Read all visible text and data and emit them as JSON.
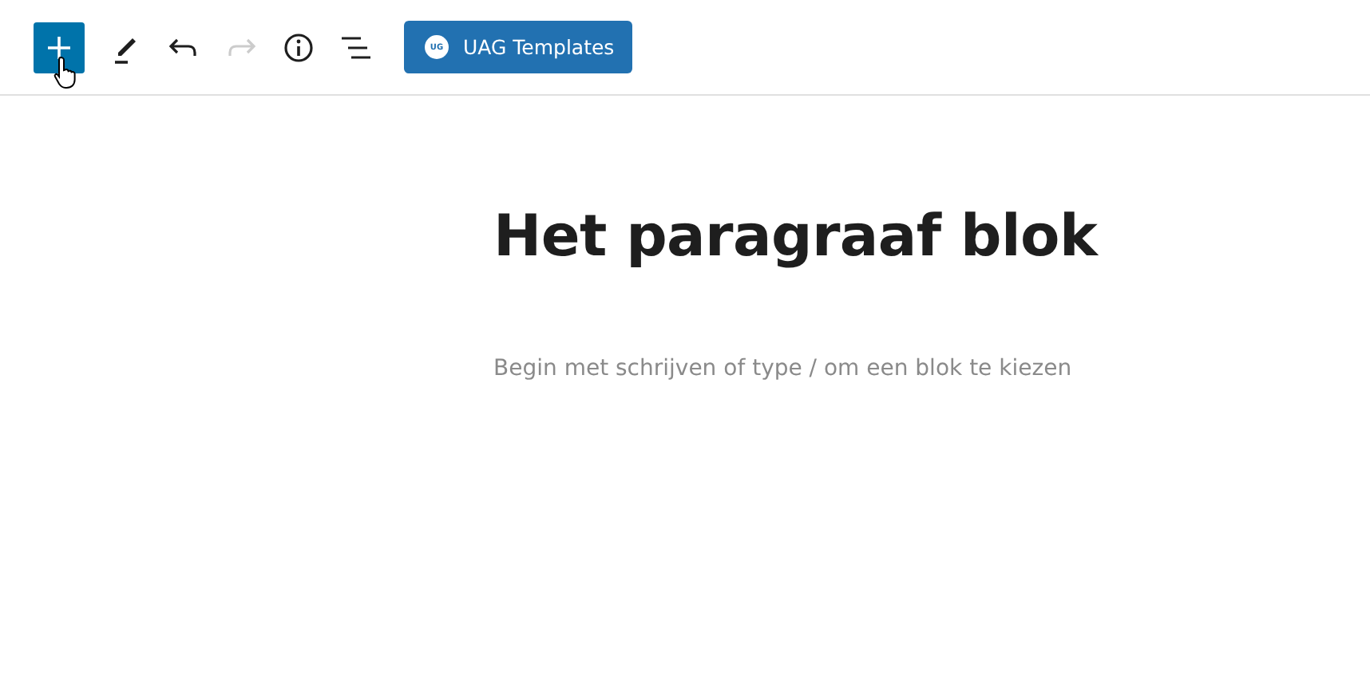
{
  "toolbar": {
    "tools": [
      {
        "kind": "add",
        "selected": true,
        "disabled": false
      },
      {
        "kind": "edit",
        "selected": false,
        "disabled": false
      },
      {
        "kind": "undo",
        "selected": false,
        "disabled": false
      },
      {
        "kind": "redo",
        "selected": false,
        "disabled": true
      },
      {
        "kind": "info",
        "selected": false,
        "disabled": false
      },
      {
        "kind": "outline",
        "selected": false,
        "disabled": false
      }
    ],
    "templates_button": {
      "badge": "UG",
      "label": "UAG Templates"
    }
  },
  "editor": {
    "title": "Het paragraaf blok",
    "paragraph": {
      "placeholder": "Begin met schrijven of type / om een blok te kiezen"
    }
  }
}
